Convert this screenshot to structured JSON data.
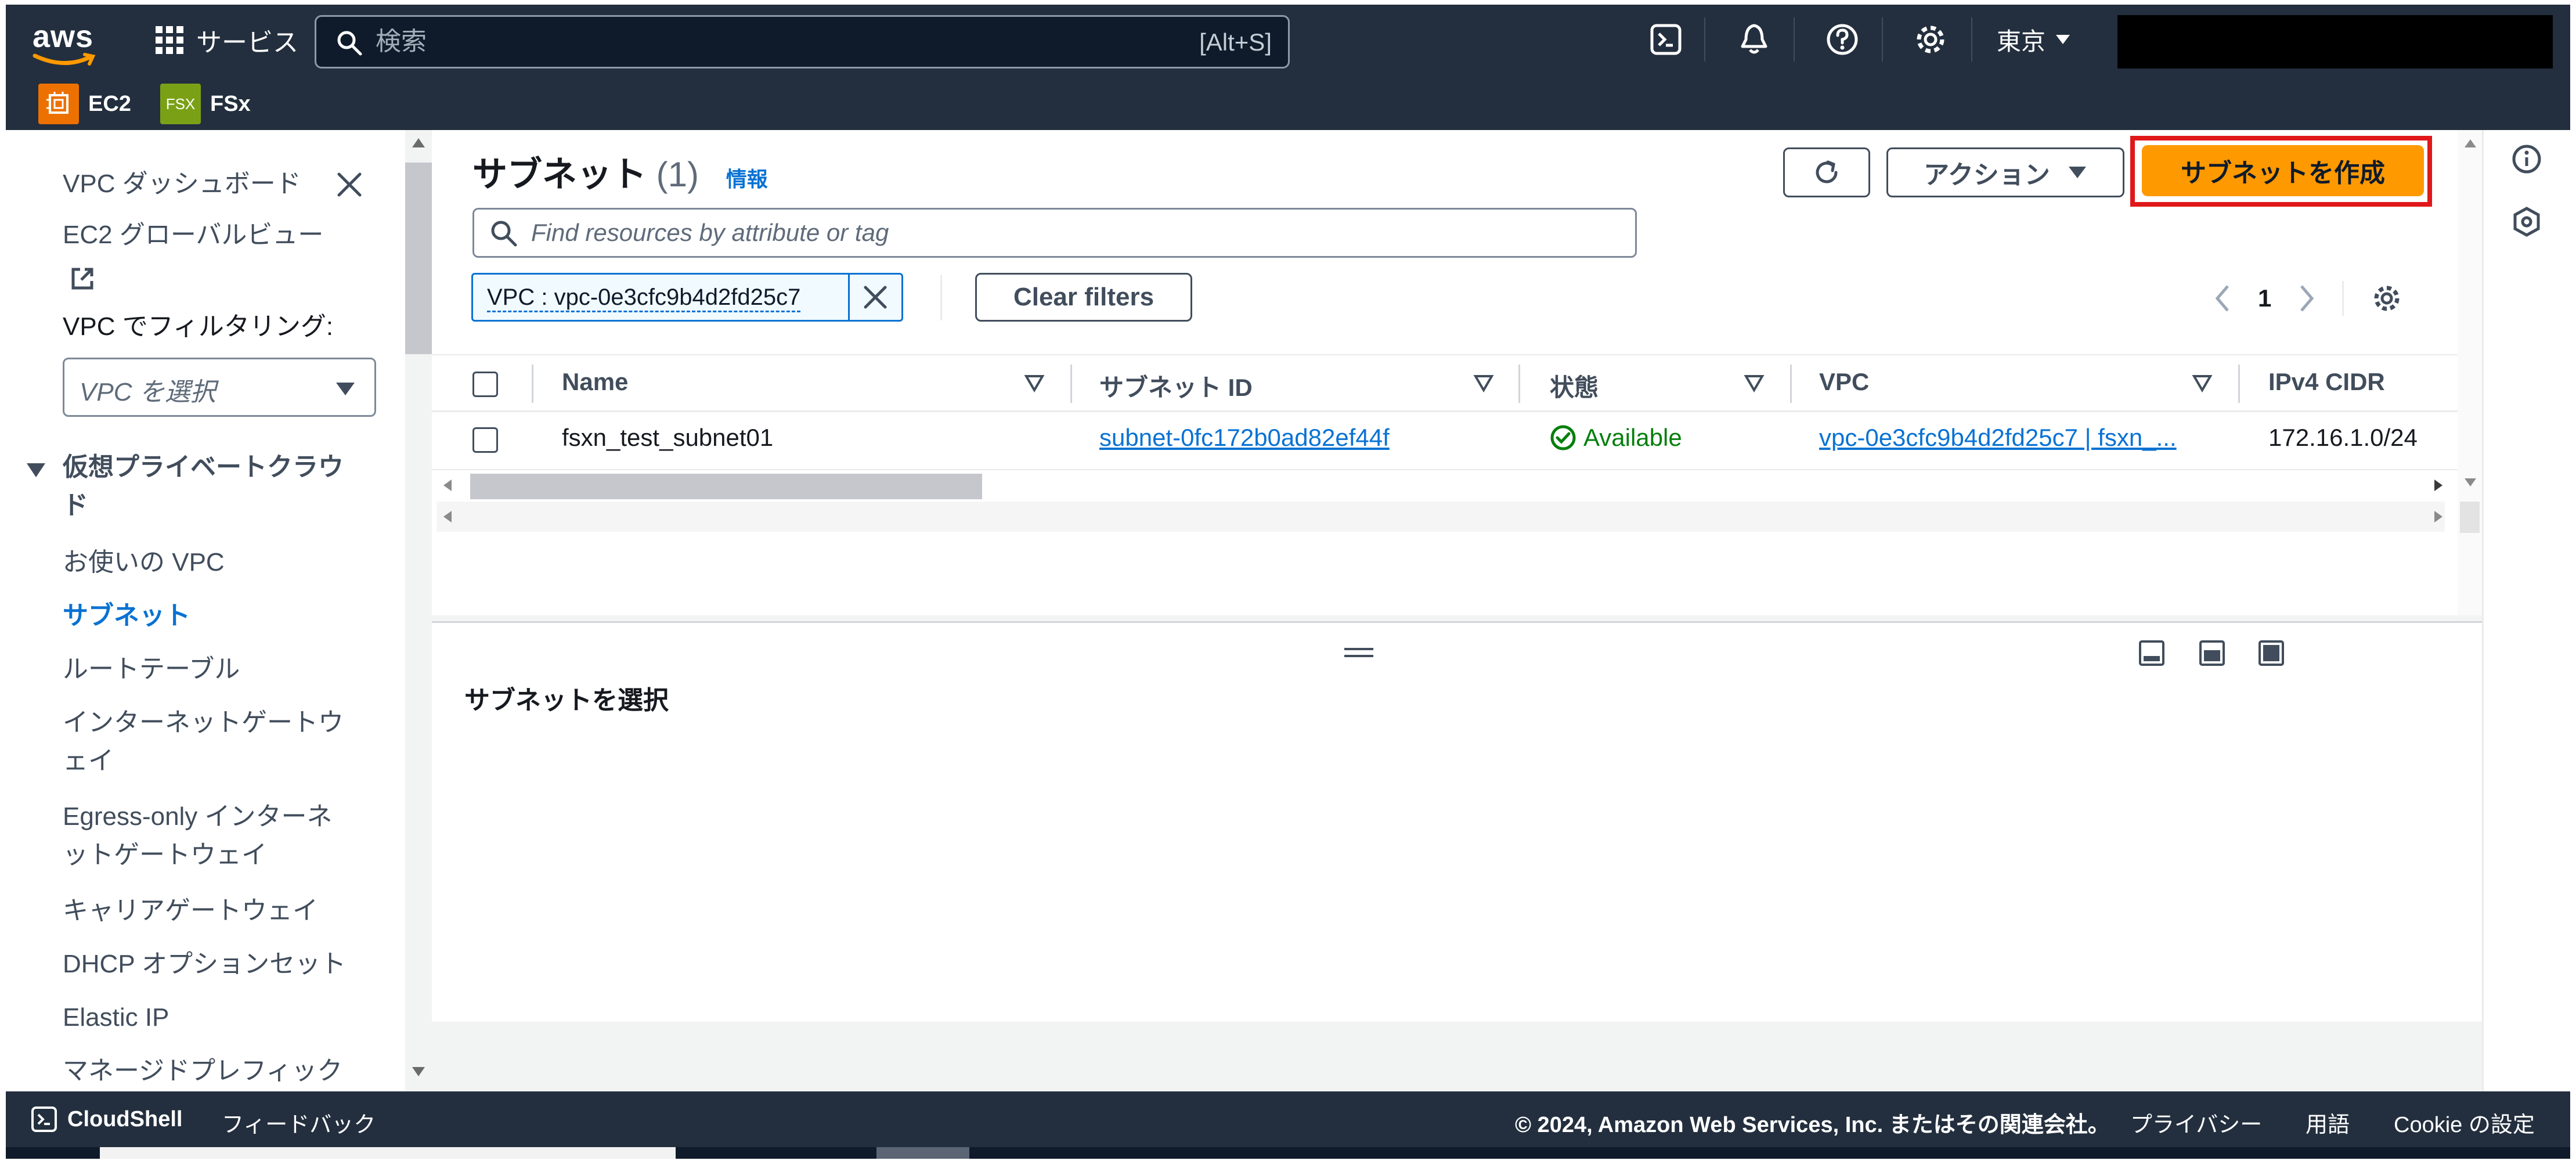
{
  "topnav": {
    "logo_text": "aws",
    "services_label": "サービス",
    "search_placeholder": "検索",
    "search_shortcut": "[Alt+S]",
    "region_label": "東京"
  },
  "favorites": [
    {
      "label": "EC2",
      "badge": "",
      "color": "#ed7100"
    },
    {
      "label": "FSx",
      "badge": "FSX",
      "color": "#7aa116"
    }
  ],
  "sidenav": {
    "dashboard_label": "VPC ダッシュボード",
    "ec2_global_view_label": "EC2 グローバルビュー",
    "filter_label": "VPC でフィルタリング:",
    "vpc_select_placeholder": "VPC を選択",
    "section_title_line1": "仮想プライベートクラウ",
    "section_title_line2": "ド",
    "items": [
      {
        "line1": "お使いの VPC"
      },
      {
        "line1": "サブネット",
        "active": true
      },
      {
        "line1": "ルートテーブル"
      },
      {
        "line1": "インターネットゲートウ",
        "line2": "ェイ"
      },
      {
        "line1": "Egress-only インターネ",
        "line2": "ットゲートウェイ"
      },
      {
        "line1": "キャリアゲートウェイ"
      },
      {
        "line1": "DHCP オプションセット"
      },
      {
        "line1": "Elastic IP"
      },
      {
        "line1": "マネージドプレフィック"
      }
    ]
  },
  "main": {
    "title": "サブネット",
    "count": "(1)",
    "info_label": "情報",
    "actions_label": "アクション",
    "create_label": "サブネットを作成",
    "filter_placeholder": "Find resources by attribute or tag",
    "token_label": "VPC : vpc-0e3cfc9b4d2fd25c7",
    "clear_filters_label": "Clear filters",
    "current_page": "1",
    "columns": [
      "Name",
      "サブネット ID",
      "状態",
      "VPC",
      "IPv4 CIDR"
    ],
    "rows": [
      {
        "name": "fsxn_test_subnet01",
        "subnet_id": "subnet-0fc172b0ad82ef44f",
        "status": "Available",
        "vpc": "vpc-0e3cfc9b4d2fd25c7 | fsxn_...",
        "ipv4_cidr": "172.16.1.0/24"
      }
    ],
    "detail_title": "サブネットを選択"
  },
  "footer": {
    "cloudshell_label": "CloudShell",
    "feedback_label": "フィードバック",
    "copyright": "© 2024, Amazon Web Services, Inc. またはその関連会社。",
    "privacy_label": "プライバシー",
    "terms_label": "用語",
    "cookie_label": "Cookie の設定"
  },
  "colors": {
    "nav_bg": "#232f3e",
    "primary_button": "#ff9900",
    "link": "#0972d3",
    "success": "#037f0c",
    "highlight": "#e0181a"
  }
}
